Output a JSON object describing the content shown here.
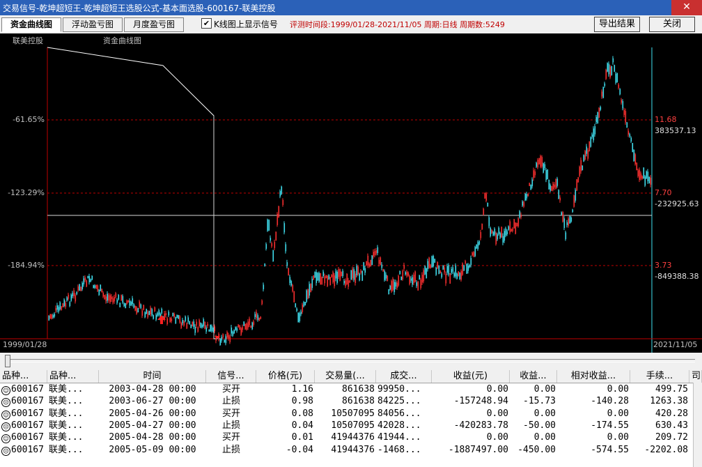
{
  "window": {
    "title": "交易信号-乾坤超短王-乾坤超短王选股公式-基本面选股-600167-联美控股",
    "close_glyph": "✕"
  },
  "toolbar": {
    "tabs": [
      "资金曲线图",
      "浮动盈亏图",
      "月度盈亏图"
    ],
    "checkbox_label": "K线图上显示信号",
    "checkbox_mark": "✔",
    "eval_text": "评测时间段:1999/01/28-2021/11/05  周期:日线  周期数:5249",
    "export_label": "导出结果",
    "close_label": "关闭"
  },
  "chart": {
    "stock_name": "联美控股",
    "title": "资金曲线图",
    "left_axis": [
      "-61.65%",
      "-123.29%",
      "-184.94%"
    ],
    "right_price": [
      "11.68",
      "7.70",
      "3.73"
    ],
    "right_value": [
      "383537.13",
      "-232925.63",
      "-849388.38"
    ],
    "start_date": "1999/01/28",
    "end_date": "2021/11/05",
    "colors": {
      "up": "#ff3030",
      "down": "#40e0f0",
      "grid": "#c00000",
      "line": "#ffffff",
      "price_label": "#ff4040"
    }
  },
  "table": {
    "columns": [
      "品种...",
      "品种...",
      "时间",
      "信号...",
      "价格(元)",
      "交易量(...",
      "成交...",
      "收益(元)",
      "收益...",
      "相对收益...",
      "手续...",
      "司"
    ],
    "rows": [
      {
        "face": "☺",
        "code": "600167",
        "name": "联美...",
        "time": "2003-04-28 00:00",
        "signal": "买开",
        "price": "1.16",
        "volume": "861638",
        "amount": "99950...",
        "profit": "0.00",
        "pct": "0.00",
        "rel": "0.00",
        "fee": "499.75"
      },
      {
        "face": "☹",
        "code": "600167",
        "name": "联美...",
        "time": "2003-06-27 00:00",
        "signal": "止损",
        "price": "0.98",
        "volume": "861638",
        "amount": "84225...",
        "profit": "-157248.94",
        "pct": "-15.73",
        "rel": "-140.28",
        "fee": "1263.38"
      },
      {
        "face": "☺",
        "code": "600167",
        "name": "联美...",
        "time": "2005-04-26 00:00",
        "signal": "买开",
        "price": "0.08",
        "volume": "10507095",
        "amount": "84056...",
        "profit": "0.00",
        "pct": "0.00",
        "rel": "0.00",
        "fee": "420.28"
      },
      {
        "face": "☹",
        "code": "600167",
        "name": "联美...",
        "time": "2005-04-27 00:00",
        "signal": "止损",
        "price": "0.04",
        "volume": "10507095",
        "amount": "42028...",
        "profit": "-420283.78",
        "pct": "-50.00",
        "rel": "-174.55",
        "fee": "630.43"
      },
      {
        "face": "☺",
        "code": "600167",
        "name": "联美...",
        "time": "2005-04-28 00:00",
        "signal": "买开",
        "price": "0.01",
        "volume": "41944376",
        "amount": "41944...",
        "profit": "0.00",
        "pct": "0.00",
        "rel": "0.00",
        "fee": "209.72"
      },
      {
        "face": "☹",
        "code": "600167",
        "name": "联美...",
        "time": "2005-05-09 00:00",
        "signal": "止损",
        "price": "-0.04",
        "volume": "41944376",
        "amount": "-1468...",
        "profit": "-1887497.00",
        "pct": "-450.00",
        "rel": "-574.55",
        "fee": "-2202.08"
      }
    ]
  }
}
